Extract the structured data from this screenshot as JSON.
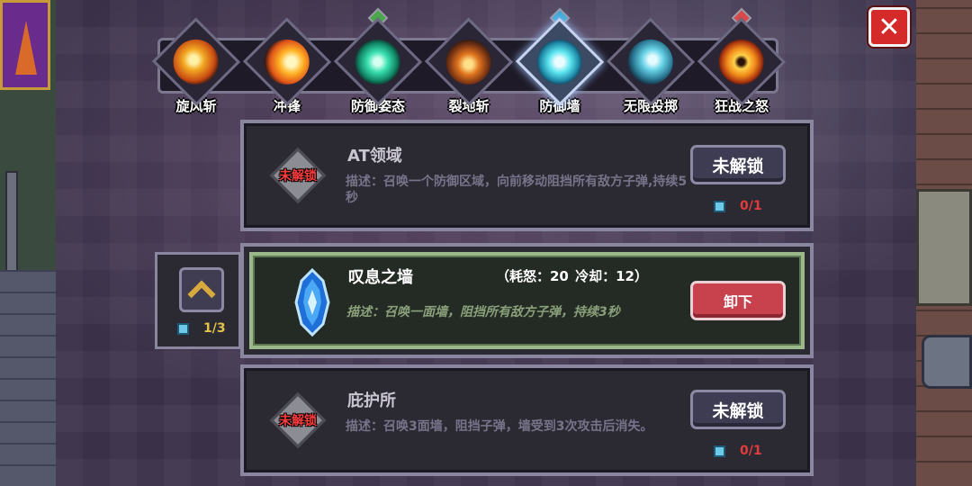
{
  "close_label": "✕",
  "skills": [
    {
      "label": "旋风斩",
      "icon": "whirlwind-slash-icon",
      "gem": ""
    },
    {
      "label": "冲锋",
      "icon": "charge-icon",
      "gem": ""
    },
    {
      "label": "防御姿态",
      "icon": "defense-stance-icon",
      "gem": "green"
    },
    {
      "label": "裂地斩",
      "icon": "ground-split-icon",
      "gem": ""
    },
    {
      "label": "防御墙",
      "icon": "defense-wall-icon",
      "gem": "blue",
      "selected": true
    },
    {
      "label": "无限投掷",
      "icon": "infinite-throw-icon",
      "gem": ""
    },
    {
      "label": "狂战之怒",
      "icon": "berserker-rage-icon",
      "gem": "red"
    }
  ],
  "cards": {
    "at_field": {
      "title": "AT领域",
      "lock_text": "未解锁",
      "desc": "描述：召唤一个防御区域，向前移动阻挡所有敌方子弹,持续5秒",
      "button": "未解锁",
      "count": "0/1"
    },
    "wall_of_sigh": {
      "title": "叹息之墙",
      "stats": "（耗怒：20  冷却：12）",
      "desc": "描述：召唤一面墙，阻挡所有敌方子弹，持续3秒",
      "button": "卸下"
    },
    "shelter": {
      "title": "庇护所",
      "lock_text": "未解锁",
      "desc": "描述：召唤3面墙，阻挡子弹，墙受到3次攻击后消失。",
      "button": "未解锁",
      "count": "0/1"
    }
  },
  "upgrade": {
    "count": "1/3"
  },
  "colors": {
    "accent_red": "#d42a2a",
    "lock_red": "#ff3b3b",
    "active_border": "#9ab88a",
    "gold": "#d8aa3e"
  }
}
